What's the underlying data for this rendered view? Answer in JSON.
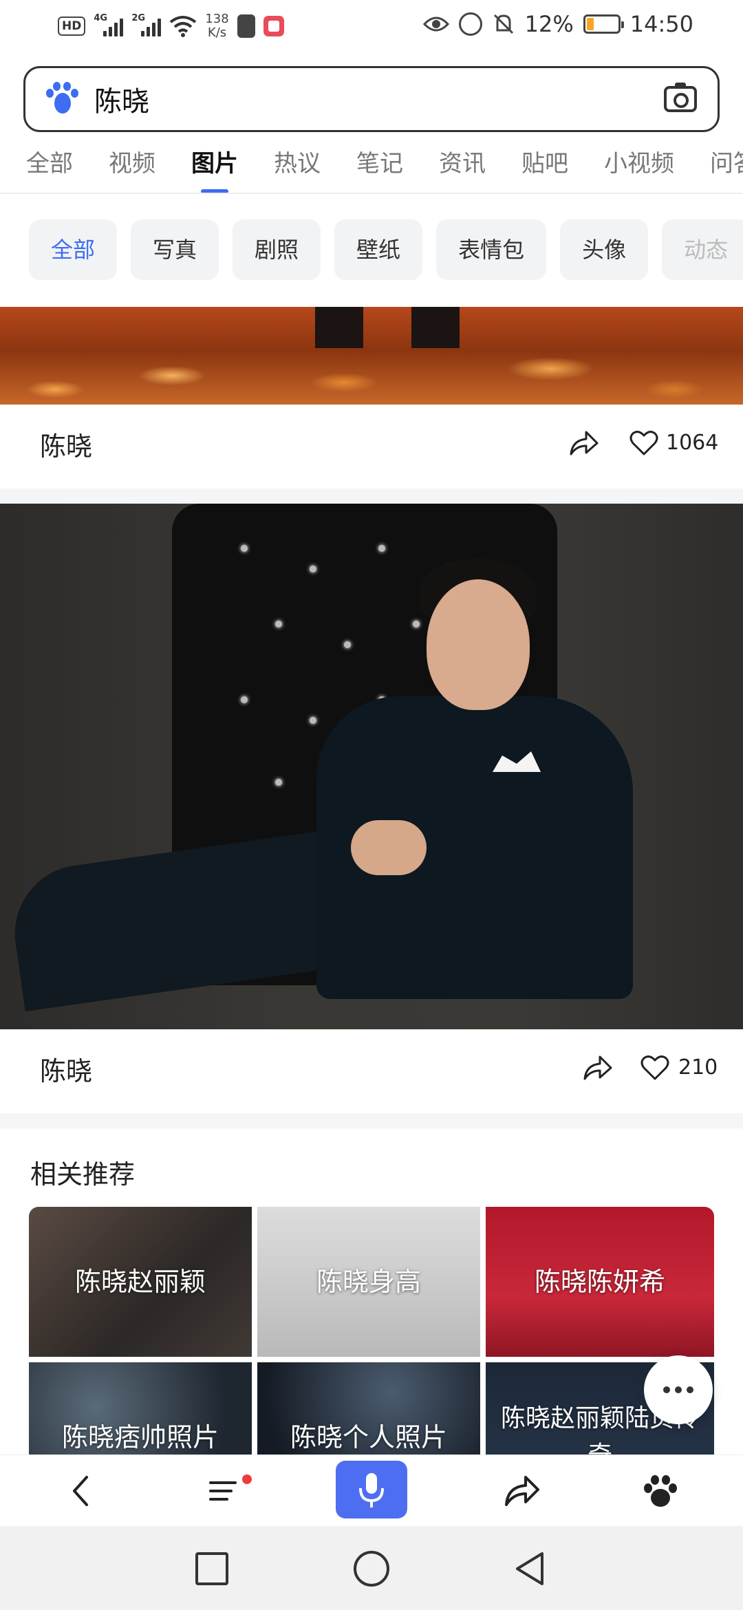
{
  "status_bar": {
    "hd_badge": "HD",
    "network1": "4G",
    "network2": "2G",
    "speed_value": "138",
    "speed_unit": "K/s",
    "battery_percent": "12%",
    "time": "14:50"
  },
  "search": {
    "query": "陈晓"
  },
  "tabs": [
    "全部",
    "视频",
    "图片",
    "热议",
    "笔记",
    "资讯",
    "贴吧",
    "小视频",
    "问答"
  ],
  "active_tab": "图片",
  "filters": [
    "全部",
    "写真",
    "剧照",
    "壁纸",
    "表情包",
    "头像",
    "动态"
  ],
  "results": [
    {
      "title": "陈晓",
      "likes": "1064"
    },
    {
      "title": "陈晓",
      "likes": "210"
    }
  ],
  "related": {
    "title": "相关推荐",
    "items": [
      "陈晓赵丽颖",
      "陈晓身高",
      "陈晓陈妍希",
      "陈晓痞帅照片",
      "陈晓个人照片",
      "陈晓赵丽颖陆贞传奇"
    ]
  },
  "colors": {
    "accent": "#3d6df0",
    "mic_button": "#4e6ef2",
    "notification_dot": "#f23a3a"
  }
}
